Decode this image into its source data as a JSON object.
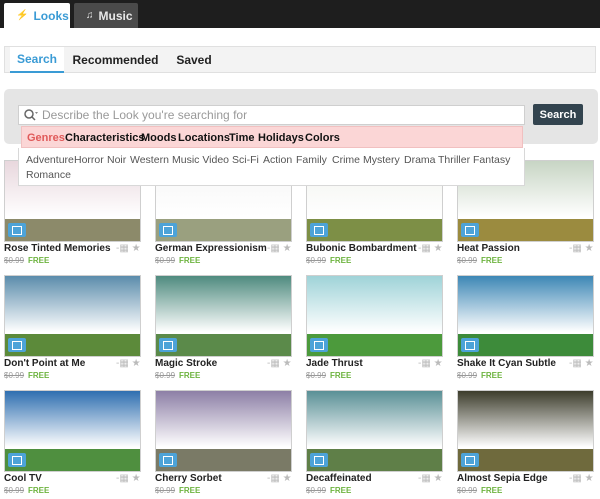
{
  "top_tabs": [
    {
      "label": "Looks",
      "icon": "lightning-icon"
    },
    {
      "label": "Music",
      "icon": "music-note-icon"
    }
  ],
  "sub_tabs": [
    "Search",
    "Recommended",
    "Saved"
  ],
  "search": {
    "placeholder": "Describe the Look you're searching for",
    "button": "Search"
  },
  "categories": [
    "Genres",
    "Characteristics",
    "Moods",
    "Locations",
    "Time",
    "Holidays",
    "Colors"
  ],
  "genres": [
    "Adventure",
    "Horror",
    "Noir",
    "Western",
    "Music Video",
    "Sci-Fi",
    "Action",
    "Family",
    "Crime",
    "Mystery",
    "Drama",
    "Thriller",
    "Fantasy",
    "Romance"
  ],
  "looks": [
    {
      "title": "Rose Tinted Memories",
      "price": "$0.99",
      "free": "FREE",
      "sky": "#e8d7dd",
      "ground": "#8c8a6a"
    },
    {
      "title": "German Expressionism",
      "price": "$0.99",
      "free": "FREE",
      "sky": "#f5f5f5",
      "ground": "#9aa07f"
    },
    {
      "title": "Bubonic Bombardment",
      "price": "$0.99",
      "free": "FREE",
      "sky": "#f1f3ee",
      "ground": "#7d8f46"
    },
    {
      "title": "Heat Passion",
      "price": "$0.99",
      "free": "FREE",
      "sky": "#c7d5c4",
      "ground": "#9b8b3f"
    },
    {
      "title": "Don't Point at Me",
      "price": "$0.99",
      "free": "FREE",
      "sky": "#5b8cab",
      "ground": "#5c8a3a"
    },
    {
      "title": "Magic Stroke",
      "price": "$0.99",
      "free": "FREE",
      "sky": "#4f8b7f",
      "ground": "#5b8a4a"
    },
    {
      "title": "Jade Thrust",
      "price": "$0.99",
      "free": "FREE",
      "sky": "#9fd3d8",
      "ground": "#4c9a3c"
    },
    {
      "title": "Shake It Cyan Subtle",
      "price": "$0.99",
      "free": "FREE",
      "sky": "#3d87b5",
      "ground": "#3d8b3a"
    },
    {
      "title": "Cool TV",
      "price": "$0.99",
      "free": "FREE",
      "sky": "#2f6fb0",
      "ground": "#4f8f3f"
    },
    {
      "title": "Cherry Sorbet",
      "price": "$0.99",
      "free": "FREE",
      "sky": "#8d7fa6",
      "ground": "#7a7a66"
    },
    {
      "title": "Decaffeinated",
      "price": "$0.99",
      "free": "FREE",
      "sky": "#5a9096",
      "ground": "#5f7f48"
    },
    {
      "title": "Almost Sepia Edge",
      "price": "$0.99",
      "free": "FREE",
      "sky": "#3d3d2c",
      "ground": "#6f6a3d"
    }
  ],
  "colors": {
    "accent": "#3a9bd5",
    "free": "#6db33f",
    "category_bar": "#fbd6d6",
    "active_category": "#e05a5a",
    "search_button": "#33444f"
  }
}
